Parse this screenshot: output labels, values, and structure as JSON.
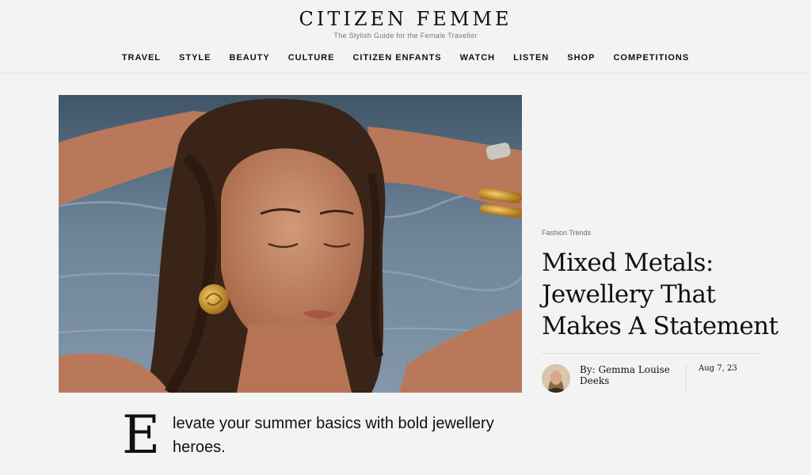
{
  "site": {
    "title": "CITIZEN FEMME",
    "tagline": "The Stylish Guide for the Female Traveller"
  },
  "nav": {
    "items": [
      {
        "label": "TRAVEL"
      },
      {
        "label": "STYLE"
      },
      {
        "label": "BEAUTY"
      },
      {
        "label": "CULTURE"
      },
      {
        "label": "CITIZEN ENFANTS"
      },
      {
        "label": "WATCH"
      },
      {
        "label": "LISTEN"
      },
      {
        "label": "SHOP"
      },
      {
        "label": "COMPETITIONS"
      }
    ]
  },
  "article": {
    "category": "Fashion Trends",
    "title": "Mixed Metals: Jewellery That Makes A Statement",
    "byline_prefix": "By: ",
    "author": "Gemma Louise Deeks",
    "date": "Aug 7, 23",
    "dropcap": "E",
    "lede": "levate your summer basics with bold jewellery heroes."
  },
  "colors": {
    "background": "#f3f3f3",
    "text": "#111111",
    "muted": "#777777",
    "water": "#6a7a8c",
    "gold": "#c9932e"
  }
}
